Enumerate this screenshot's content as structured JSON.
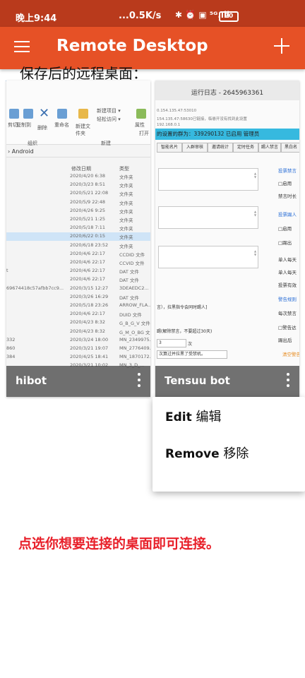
{
  "status_bar": {
    "time": "晚上9:44",
    "speed": "...0.5K/s",
    "icons": "✱ ⏰ ▣ ⁵ᴳ.ıll",
    "battery": "20"
  },
  "app_bar": {
    "title": "Remote Desktop",
    "menu_icon": "hamburger-menu-icon",
    "add_icon": "plus-icon",
    "color": "#e65126",
    "status_color": "#b93a1c"
  },
  "caption": "保存后的远程桌面：",
  "desktops": [
    {
      "name": "hibot",
      "thumbnail": {
        "path": "› Android",
        "columns": [
          "修改日期",
          "类型"
        ],
        "ribbon_labels": [
          "新建项目 ▾",
          "轻松访问 ▾",
          "新建",
          "属性",
          "剪切",
          "复制到",
          "删除",
          "重命名",
          "新建文件夹",
          "组织",
          "打开"
        ],
        "rows": [
          {
            "name": "",
            "date": "2020/4/20 6:38",
            "type": "文件夹"
          },
          {
            "name": "",
            "date": "2020/3/23 8:51",
            "type": "文件夹"
          },
          {
            "name": "",
            "date": "2020/5/21 22:08",
            "type": "文件夹"
          },
          {
            "name": "",
            "date": "2020/5/9 22:48",
            "type": "文件夹"
          },
          {
            "name": "",
            "date": "2020/4/26 9:25",
            "type": "文件夹"
          },
          {
            "name": "",
            "date": "2020/5/21 1:25",
            "type": "文件夹"
          },
          {
            "name": "",
            "date": "2020/5/18 7:11",
            "type": "文件夹"
          },
          {
            "name": "",
            "date": "2020/6/22 0:15",
            "type": "文件夹"
          },
          {
            "name": "",
            "date": "2020/6/18 23:52",
            "type": "文件夹"
          },
          {
            "name": "",
            "date": "2020/4/6 22:17",
            "type": "CCDID 文件"
          },
          {
            "name": "",
            "date": "2020/4/6 22:17",
            "type": "CCVID 文件"
          },
          {
            "name": "t",
            "date": "2020/4/6 22:17",
            "type": "DAT 文件"
          },
          {
            "name": "",
            "date": "2020/4/6 22:17",
            "type": "DAT 文件"
          },
          {
            "name": "69674418c57afbb7cc9...",
            "date": "2020/3/15 12:27",
            "type": "3DEAEDC2..."
          },
          {
            "name": "",
            "date": "2020/3/26 16:29",
            "type": "DAT 文件"
          },
          {
            "name": "",
            "date": "2020/5/18 23:26",
            "type": "ARROW_FLA..."
          },
          {
            "name": "",
            "date": "2020/4/6 22:17",
            "type": "DUID 文件"
          },
          {
            "name": "",
            "date": "2020/4/23 8:32",
            "type": "G_B_G_V 文件"
          },
          {
            "name": "",
            "date": "2020/4/23 8:32",
            "type": "G_M_O_BG 文"
          },
          {
            "name": "332",
            "date": "2020/3/24 18:00",
            "type": "MN_2349975..."
          },
          {
            "name": "860",
            "date": "2020/3/21 19:07",
            "type": "MN_2776409..."
          },
          {
            "name": "384",
            "date": "2020/4/25 18:41",
            "type": "MN_1870172..."
          },
          {
            "name": "",
            "date": "2020/3/21 10:02",
            "type": "MN_3_D_..."
          }
        ]
      }
    },
    {
      "name": "Tensuu bot",
      "thumbnail": {
        "title": "运行日志 - 2645963361",
        "lines": [
          "0.154.135.47:53010",
          "154.135.47:58630已链接，临悬开没有找到此设置",
          "192.168.0.1"
        ],
        "group_bar": "的设置的群为：339290132 已启用  管理员",
        "tabs": [
          "智能名片",
          "入群审核",
          "邀请统计",
          "定时任务",
          "踢人禁言",
          "黑白名"
        ],
        "side_items": [
          "投票禁言",
          "□启用",
          "禁言时长",
          "投票踢人",
          "□启用",
          "□踢出",
          "单人每天",
          "单人每天",
          "投票有效",
          "警告规则",
          "每次禁言",
          "□警告达",
          "踢出后",
          "清空警告"
        ],
        "footer_lines": [
          "言），拉黑指令会同时踢人]",
          "踢(解除禁言，不要超过30天)"
        ],
        "warn_count": "3",
        "warn_unit": "次",
        "warn_text": "次算过并拉黑了受禁机。"
      }
    }
  ],
  "context_menu": {
    "items": [
      {
        "en": "Edit",
        "zh": "编辑"
      },
      {
        "en": "Remove",
        "zh": "移除"
      }
    ]
  },
  "instruction": "点选你想要连接的桌面即可连接。",
  "colors": {
    "instruction": "#e8202a",
    "card_footer": "#3c3c3c"
  }
}
